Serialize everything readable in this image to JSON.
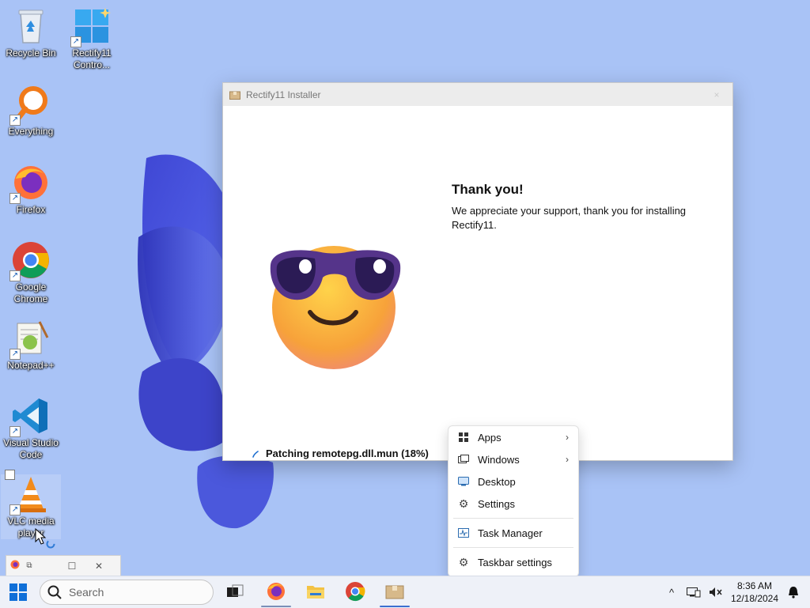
{
  "desktop": {
    "icons": [
      {
        "name": "recycle-bin",
        "label": "Recycle Bin"
      },
      {
        "name": "rectify11-control",
        "label": "Rectify11 Contro..."
      },
      {
        "name": "everything",
        "label": "Everything"
      },
      {
        "name": "firefox",
        "label": "Firefox"
      },
      {
        "name": "google-chrome",
        "label": "Google Chrome"
      },
      {
        "name": "notepad-plus-plus",
        "label": "Notepad++"
      },
      {
        "name": "visual-studio-code",
        "label": "Visual Studio Code"
      },
      {
        "name": "vlc-media-player",
        "label": "VLC media player"
      }
    ]
  },
  "installer": {
    "title": "Rectify11 Installer",
    "close_glyph": "×",
    "heading": "Thank you!",
    "message": "We appreciate your support, thank you for installing Rectify11.",
    "status": "Patching remotepg.dll.mun (18%)",
    "progress_percent": 18
  },
  "context_menu": {
    "items": [
      {
        "label": "Apps",
        "icon": "apps-icon",
        "submenu": true
      },
      {
        "label": "Windows",
        "icon": "windows-icon",
        "submenu": true
      },
      {
        "label": "Desktop",
        "icon": "desktop-icon",
        "submenu": false
      },
      {
        "label": "Settings",
        "icon": "gear-icon",
        "submenu": false
      },
      {
        "label": "Task Manager",
        "icon": "task-manager-icon",
        "submenu": false
      },
      {
        "label": "Taskbar settings",
        "icon": "gear-icon",
        "submenu": false
      }
    ],
    "chevron": "›"
  },
  "mini_window": {
    "maximize_glyph": "☐",
    "close_glyph": "✕"
  },
  "taskbar": {
    "search_placeholder": "Search",
    "apps": [
      "task-view",
      "firefox",
      "file-explorer",
      "google-chrome",
      "rectify11-installer"
    ],
    "tray": {
      "chevron": "^",
      "time": "8:36 AM",
      "date": "12/18/2024"
    }
  },
  "colors": {
    "desktop_bg": "#a9c3f6",
    "accent": "#0067c0",
    "bloom": "#4a55d4"
  }
}
